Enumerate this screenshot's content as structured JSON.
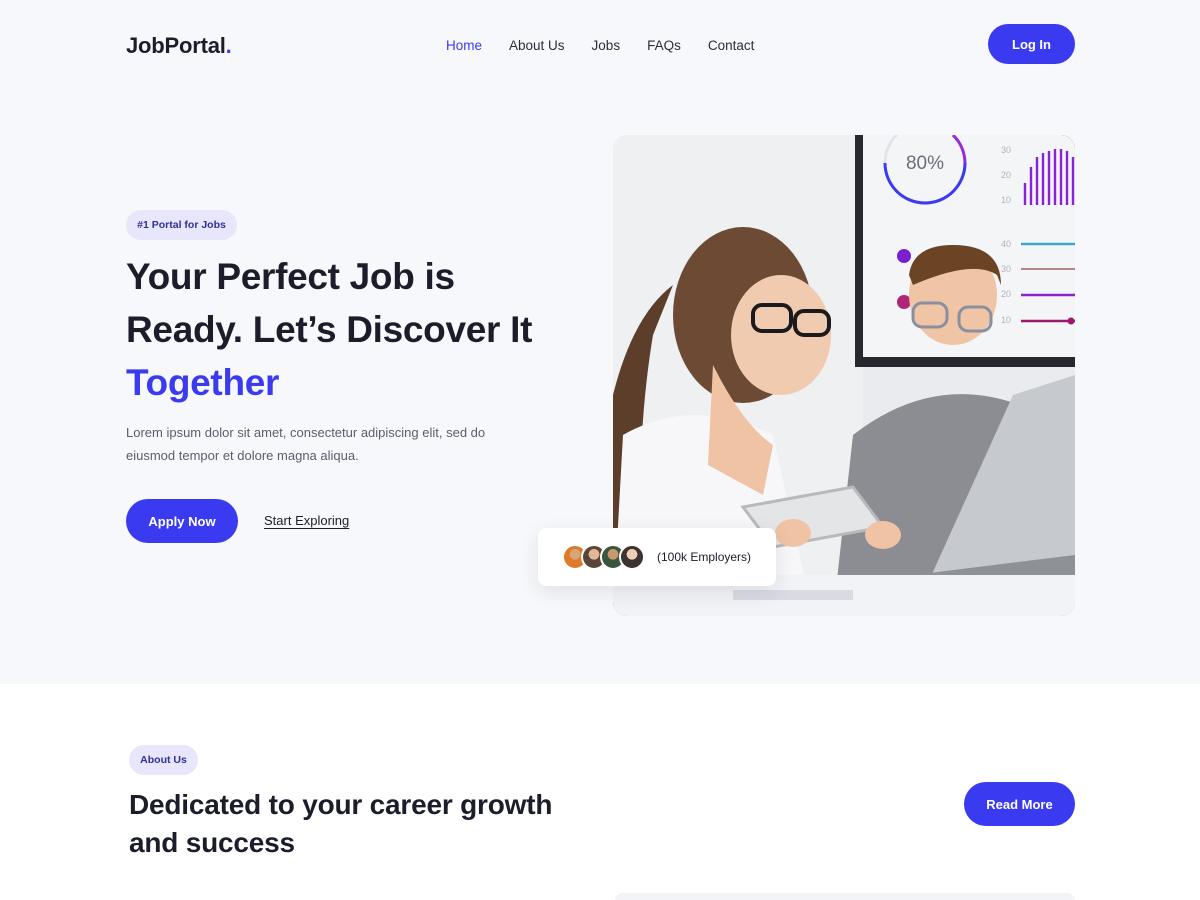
{
  "brand": {
    "name": "JobPortal",
    "dot": "."
  },
  "nav": {
    "items": [
      {
        "label": "Home",
        "active": true
      },
      {
        "label": "About Us",
        "active": false
      },
      {
        "label": "Jobs",
        "active": false
      },
      {
        "label": "FAQs",
        "active": false
      },
      {
        "label": "Contact",
        "active": false
      }
    ],
    "login_label": "Log In"
  },
  "hero": {
    "badge": "#1 Portal for Jobs",
    "title_line1": "Your Perfect Job is",
    "title_line2": "Ready. Let’s Discover It",
    "title_highlight": "Together",
    "description": "Lorem ipsum dolor sit amet, consectetur adipiscing elit, sed do eiusmod tempor et dolore magna aliqua.",
    "apply_label": "Apply Now",
    "explore_label": "Start Exploring",
    "image_screen": {
      "gauge_label": "80%",
      "axis_top": [
        "30",
        "20",
        "10"
      ],
      "axis_lines": [
        "40",
        "30",
        "20",
        "10"
      ]
    },
    "employers_text": "(100k Employers)"
  },
  "about": {
    "badge": "About Us",
    "title": "Dedicated to your career growth and success",
    "read_more_label": "Read More"
  },
  "colors": {
    "accent": "#3a3bf0",
    "hero_bg": "#f7f8fb",
    "pill_bg": "#e7e6fb"
  }
}
